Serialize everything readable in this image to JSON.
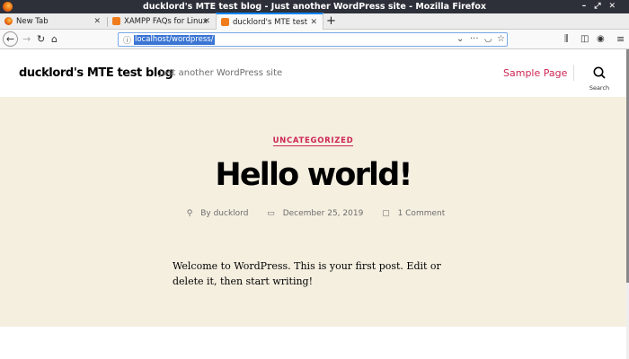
{
  "window": {
    "title": "ducklord's MTE test blog - Just another WordPress site - Mozilla Firefox",
    "controls": [
      "–",
      "⤢",
      "✕"
    ]
  },
  "tabs": [
    {
      "label": "New Tab"
    },
    {
      "label": "XAMPP FAQs for Linux"
    },
    {
      "label": "ducklord's MTE test blog"
    }
  ],
  "nav": {
    "url": "localhost/wordpress/"
  },
  "site": {
    "title": "ducklord's MTE test blog",
    "tagline": "Just another WordPress site",
    "menu": "Sample Page",
    "search_label": "Search"
  },
  "post": {
    "category": "UNCATEGORIZED",
    "title": "Hello world!",
    "author": "By ducklord",
    "date": "December 25, 2019",
    "comments": "1 Comment",
    "body": "Welcome to WordPress. This is your first post. Edit or delete it, then start writing!"
  },
  "colors": {
    "accent": "#cd2653",
    "hero_bg": "#f5efe0"
  }
}
